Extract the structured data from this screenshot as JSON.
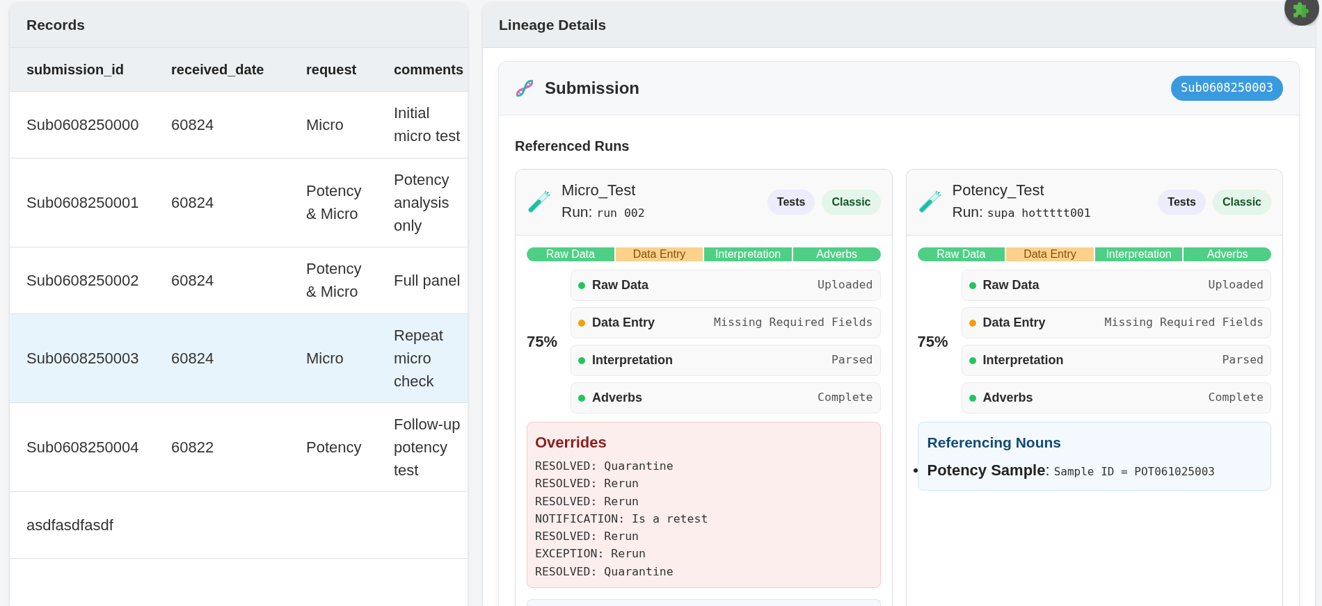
{
  "records_panel": {
    "title": "Records",
    "columns": [
      "submission_id",
      "received_date",
      "request",
      "comments"
    ],
    "rows": [
      {
        "cells": [
          "Sub0608250000",
          "60824",
          "Micro",
          "Initial micro test"
        ],
        "selected": false
      },
      {
        "cells": [
          "Sub0608250001",
          "60824",
          "Potency & Micro",
          "Potency analysis only"
        ],
        "selected": false
      },
      {
        "cells": [
          "Sub0608250002",
          "60824",
          "Potency & Micro",
          "Full panel"
        ],
        "selected": false
      },
      {
        "cells": [
          "Sub0608250003",
          "60824",
          "Micro",
          "Repeat micro check"
        ],
        "selected": true
      },
      {
        "cells": [
          "Sub0608250004",
          "60822",
          "Potency",
          "Follow-up potency test"
        ],
        "selected": false
      },
      {
        "cells": [
          "asdfasdfasdf"
        ],
        "selected": false
      }
    ]
  },
  "lineage_panel": {
    "title": "Lineage Details",
    "submission": {
      "title": "Submission",
      "id_badge": "Sub0608250003",
      "runs_heading": "Referenced Runs",
      "runs": [
        {
          "name": "Micro_Test",
          "run_label": "Run:",
          "run_id": "run 002",
          "tags": [
            {
              "label": "Tests",
              "kind": "category"
            },
            {
              "label": "Classic",
              "kind": "variant"
            }
          ],
          "stage_bar": [
            {
              "label": "Raw Data",
              "warning": false
            },
            {
              "label": "Data Entry",
              "warning": true
            },
            {
              "label": "Interpretation",
              "warning": false
            },
            {
              "label": "Adverbs",
              "warning": false
            }
          ],
          "progress": "75%",
          "stages": [
            {
              "label": "Raw Data",
              "status": "Uploaded",
              "warning": false
            },
            {
              "label": "Data Entry",
              "status": "Missing Required Fields",
              "warning": true
            },
            {
              "label": "Interpretation",
              "status": "Parsed",
              "warning": false
            },
            {
              "label": "Adverbs",
              "status": "Complete",
              "warning": false
            }
          ],
          "sections": [
            {
              "kind": "overrides",
              "title": "Overrides",
              "lines": [
                "RESOLVED: Quarantine",
                "RESOLVED: Rerun",
                "RESOLVED: Rerun",
                "NOTIFICATION: Is a retest",
                "RESOLVED: Rerun",
                "EXCEPTION: Rerun",
                "RESOLVED: Quarantine"
              ]
            },
            {
              "kind": "nouns"
            }
          ]
        },
        {
          "name": "Potency_Test",
          "run_label": "Run:",
          "run_id": "supa hottttt001",
          "tags": [
            {
              "label": "Tests",
              "kind": "category"
            },
            {
              "label": "Classic",
              "kind": "variant"
            }
          ],
          "stage_bar": [
            {
              "label": "Raw Data",
              "warning": false
            },
            {
              "label": "Data Entry",
              "warning": true
            },
            {
              "label": "Interpretation",
              "warning": false
            },
            {
              "label": "Adverbs",
              "warning": false
            }
          ],
          "progress": "75%",
          "stages": [
            {
              "label": "Raw Data",
              "status": "Uploaded",
              "warning": false
            },
            {
              "label": "Data Entry",
              "status": "Missing Required Fields",
              "warning": true
            },
            {
              "label": "Interpretation",
              "status": "Parsed",
              "warning": false
            },
            {
              "label": "Adverbs",
              "status": "Complete",
              "warning": false
            }
          ],
          "sections": [
            {
              "kind": "nouns",
              "title": "Referencing Nouns",
              "items": [
                {
                  "label": "**Potency Sample**:",
                  "value": "Sample ID = POT061025003"
                }
              ]
            }
          ]
        }
      ]
    }
  }
}
